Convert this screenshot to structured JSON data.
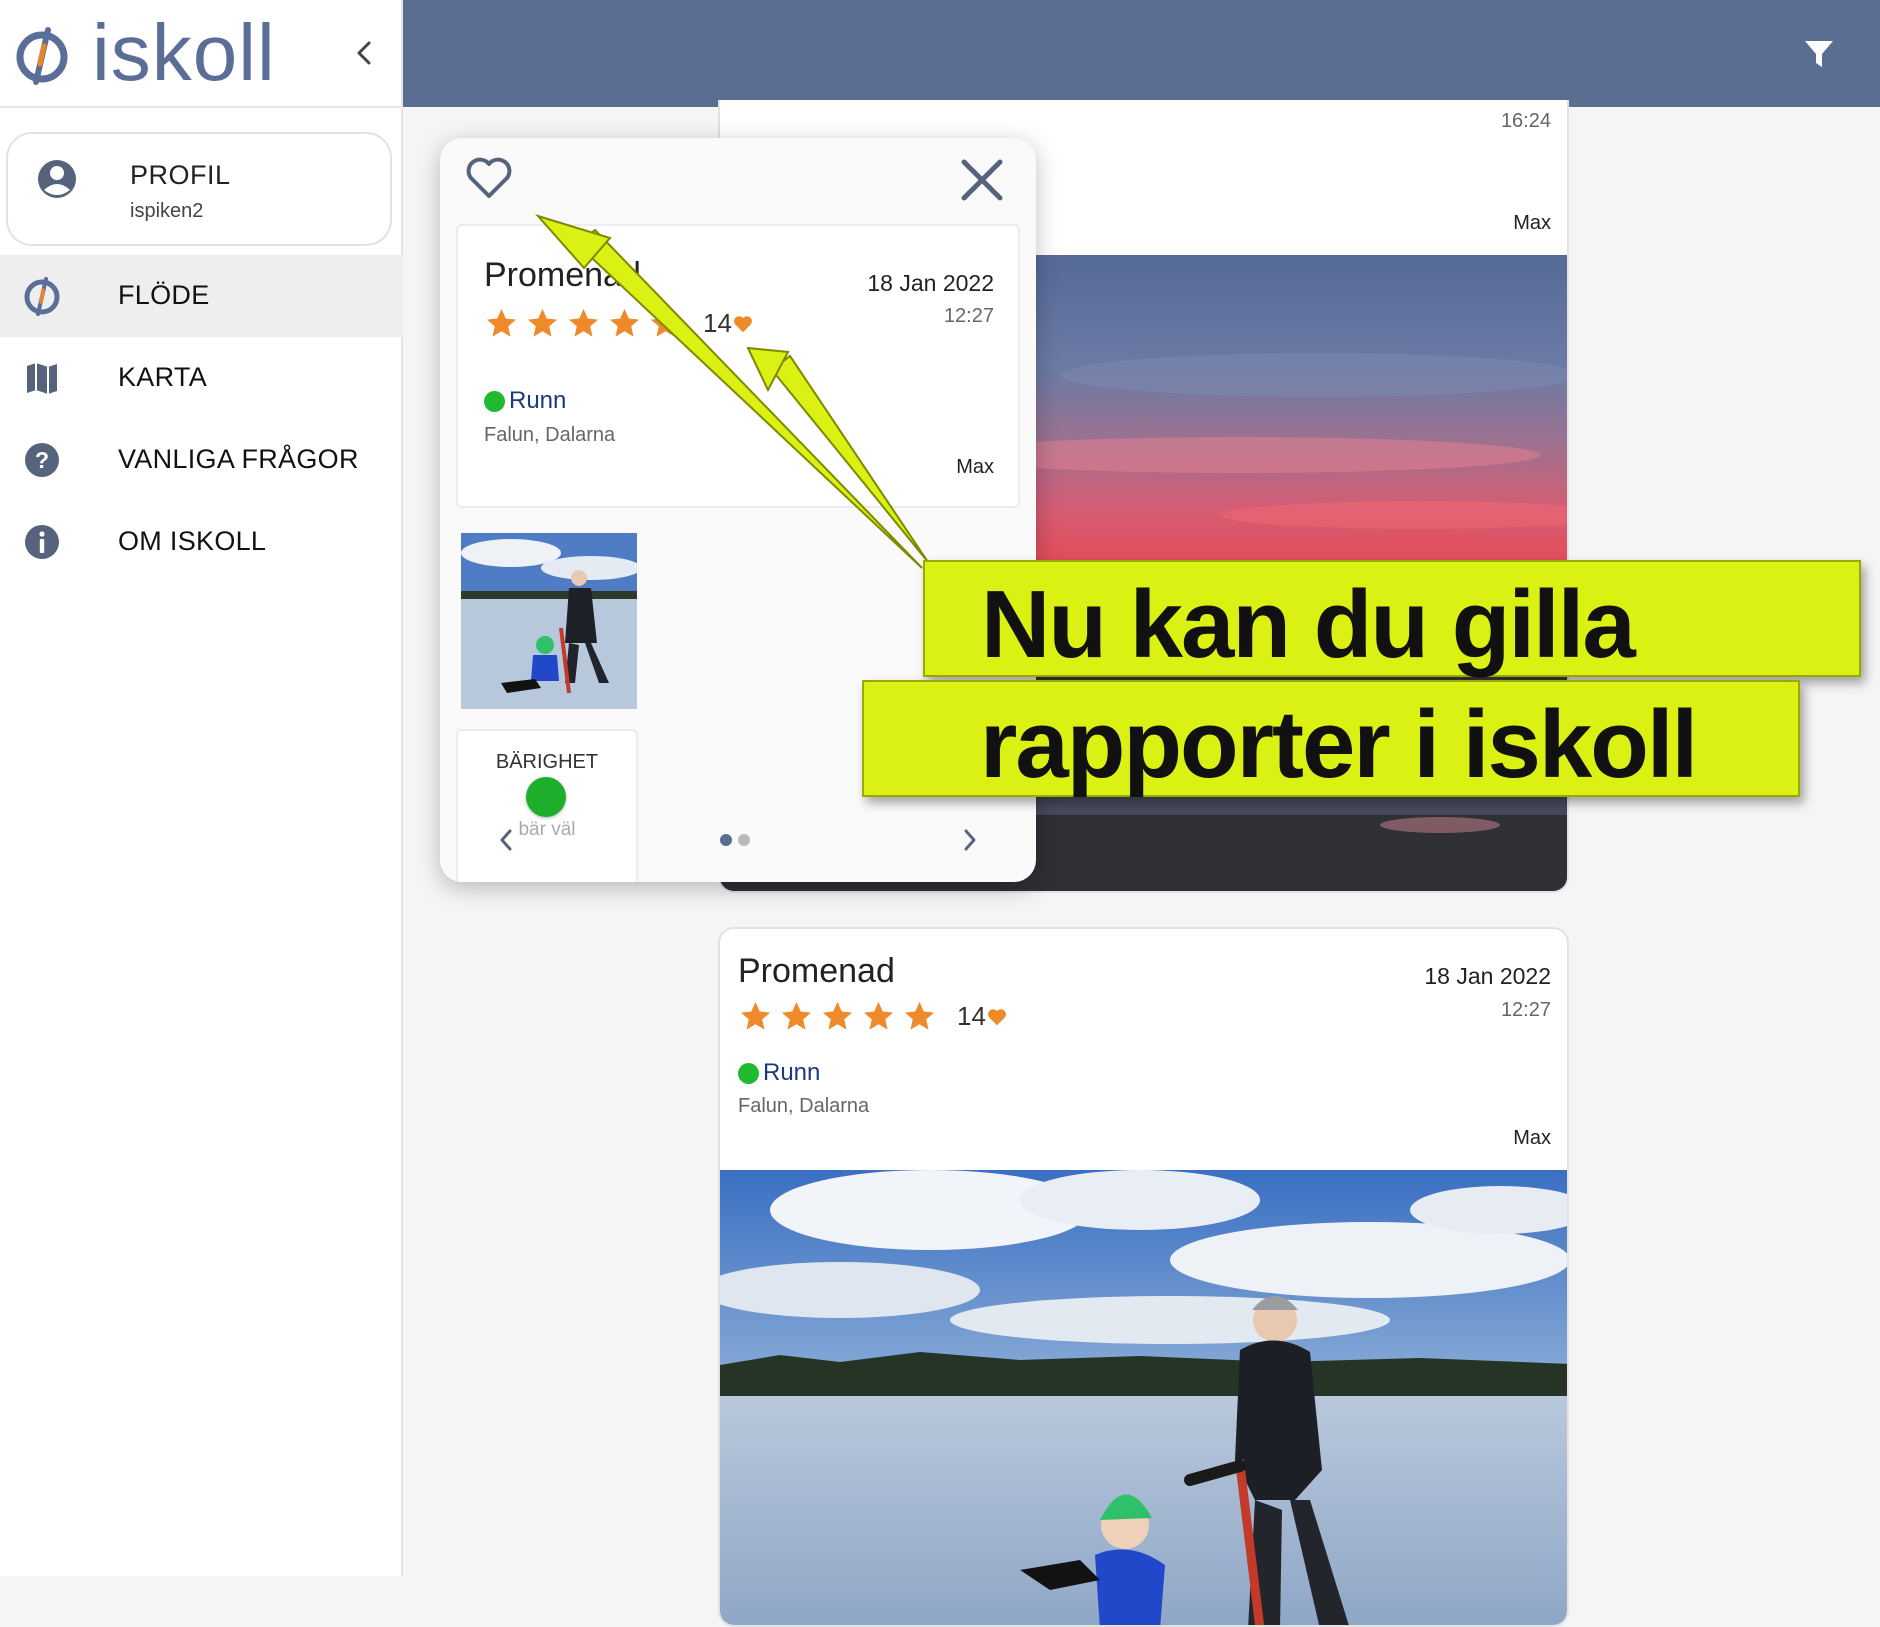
{
  "app": {
    "name": "iskoll"
  },
  "profile": {
    "heading": "PROFIL",
    "username": "ispiken2"
  },
  "nav": [
    {
      "label": "FLÖDE",
      "icon": "iskoll-logo-icon",
      "active": true
    },
    {
      "label": "KARTA",
      "icon": "map-icon",
      "active": false
    },
    {
      "label": "VANLIGA FRÅGOR",
      "icon": "help-icon",
      "active": false
    },
    {
      "label": "OM ISKOLL",
      "icon": "info-icon",
      "active": false
    }
  ],
  "colors": {
    "header": "#5a6e92",
    "brand": "#5a6e97",
    "star": "#ee8a2a",
    "status_good": "#1fba2f",
    "promo": "#dbf113"
  },
  "feed": {
    "card1": {
      "time": "16:24",
      "user": "Max"
    },
    "card2": {
      "title": "Promenad",
      "date": "18 Jan 2022",
      "time": "12:27",
      "rating": 5,
      "likes": "14",
      "status": "Runn",
      "location": "Falun, Dalarna",
      "user": "Max"
    }
  },
  "modal": {
    "title": "Promenad",
    "date": "18 Jan 2022",
    "time": "12:27",
    "rating": 5,
    "likes": "14",
    "status": "Runn",
    "location": "Falun, Dalarna",
    "user": "Max",
    "bearing": {
      "label": "BÄRIGHET",
      "value": "bär väl"
    },
    "pager": {
      "current": 1,
      "total": 2
    }
  },
  "promo": {
    "line1": "Nu kan du gilla",
    "line2": "rapporter i iskoll"
  }
}
